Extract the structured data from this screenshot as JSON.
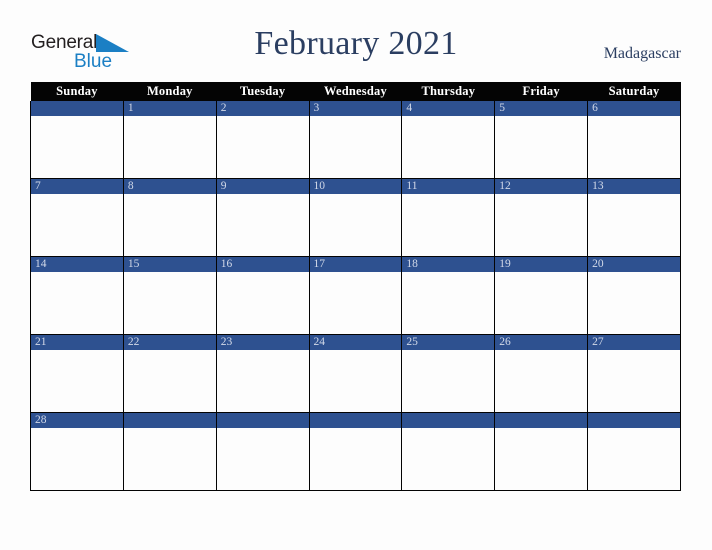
{
  "logo": {
    "word_one": "General",
    "word_two": "Blue",
    "triangle_icon": "triangle-icon",
    "color_dark": "#231f20",
    "color_blue": "#1b7fc4"
  },
  "header": {
    "title": "February 2021",
    "country": "Madagascar",
    "title_color": "#2b3e61"
  },
  "calendar": {
    "month": "February",
    "year": "2021",
    "weekday_headers": [
      "Sunday",
      "Monday",
      "Tuesday",
      "Wednesday",
      "Thursday",
      "Friday",
      "Saturday"
    ],
    "header_bg": "#040404",
    "header_fg": "#ffffff",
    "date_band_bg": "#2e5190",
    "date_band_fg": "#d2d9e8",
    "cell_bg": "#fdfdfd",
    "grid_color": "#040404",
    "weeks": [
      [
        "",
        "1",
        "2",
        "3",
        "4",
        "5",
        "6"
      ],
      [
        "7",
        "8",
        "9",
        "10",
        "11",
        "12",
        "13"
      ],
      [
        "14",
        "15",
        "16",
        "17",
        "18",
        "19",
        "20"
      ],
      [
        "21",
        "22",
        "23",
        "24",
        "25",
        "26",
        "27"
      ],
      [
        "28",
        "",
        "",
        "",
        "",
        "",
        ""
      ]
    ]
  }
}
